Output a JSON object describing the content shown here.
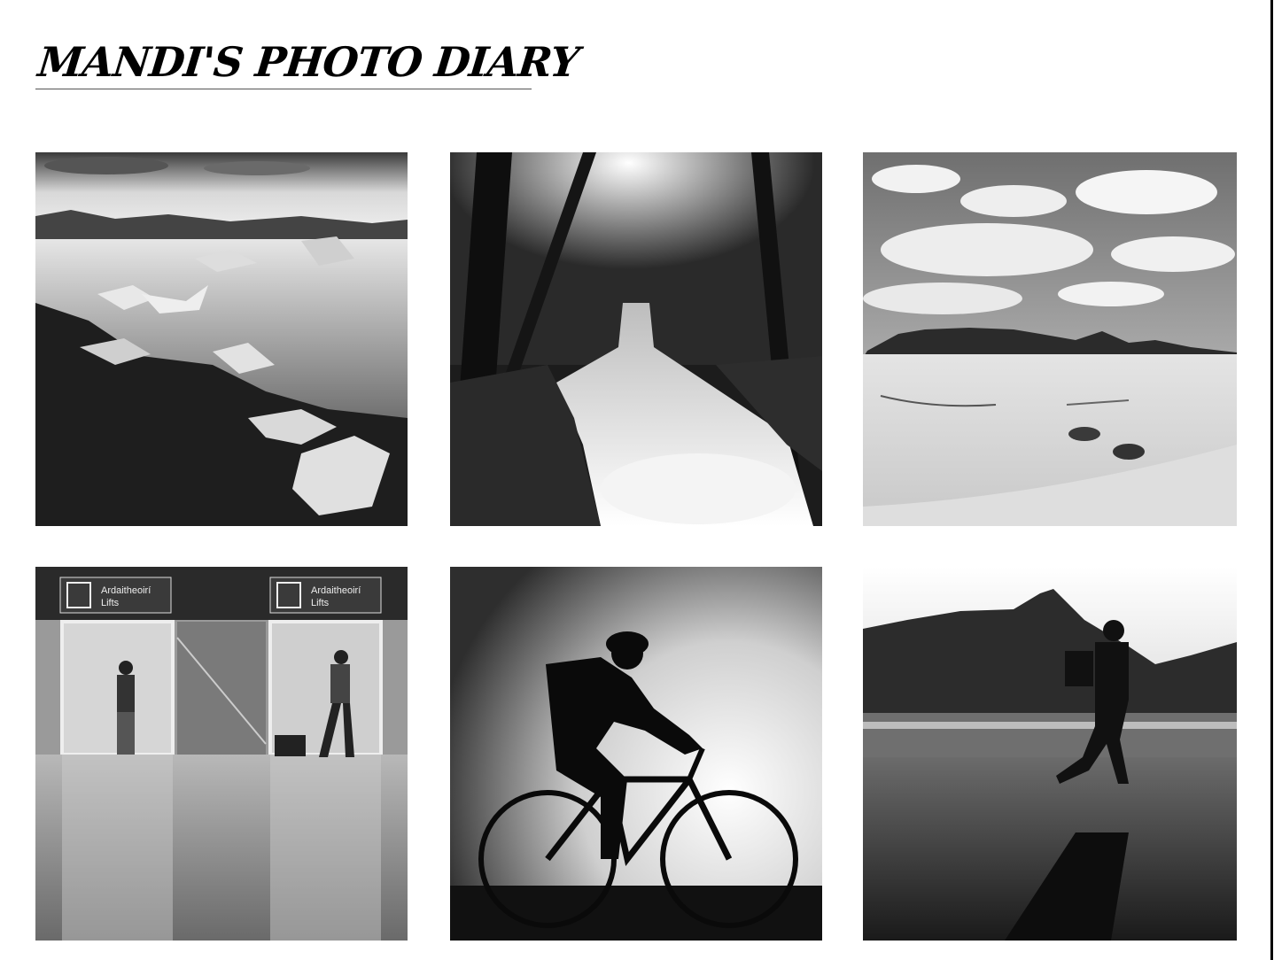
{
  "site": {
    "title": "MANDI'S PHOTO DIARY"
  },
  "gallery": {
    "photos": [
      {
        "subject": "glacier-lagoon"
      },
      {
        "subject": "forest-waterfall"
      },
      {
        "subject": "desert-dunes"
      },
      {
        "subject": "airport-lifts",
        "signs": [
          {
            "line1": "Ardaitheoirí",
            "line2": "Lifts"
          },
          {
            "line1": "Ardaitheoirí",
            "line2": "Lifts"
          }
        ]
      },
      {
        "subject": "cyclist-silhouette"
      },
      {
        "subject": "walker-waterfront"
      }
    ]
  }
}
